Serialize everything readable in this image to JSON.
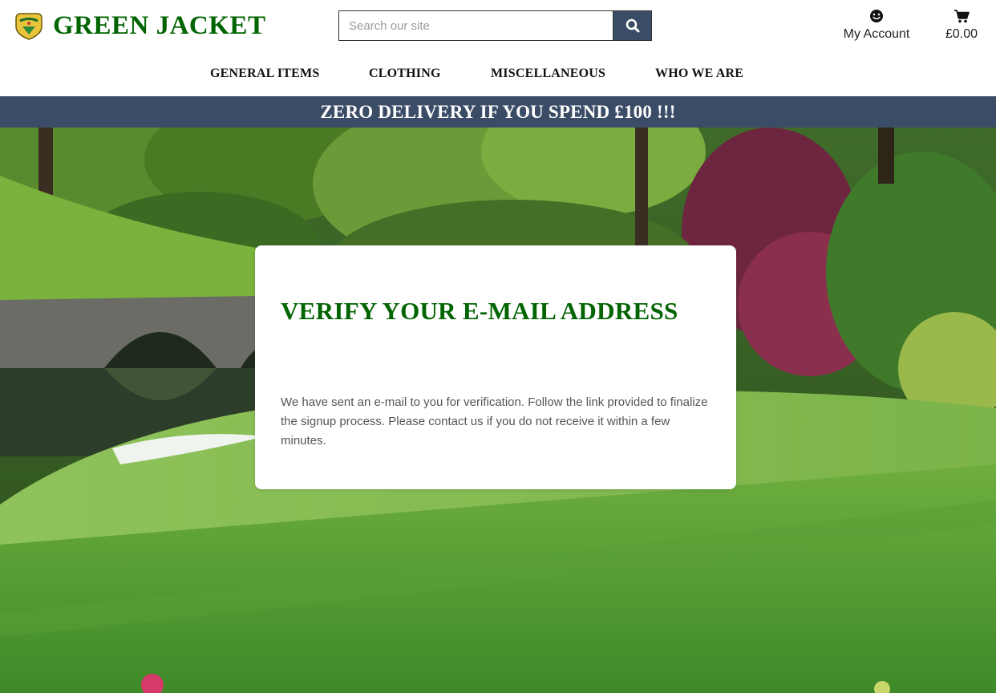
{
  "brand": {
    "name": "GREEN JACKET",
    "logo_icon": "masters-logo-icon",
    "color": "#006400"
  },
  "search": {
    "placeholder": "Search our site",
    "value": "",
    "button_icon": "search-icon"
  },
  "account": {
    "label": "My Account",
    "icon": "smiley-icon"
  },
  "cart": {
    "total": "£0.00",
    "icon": "shopping-cart-icon"
  },
  "nav": {
    "items": [
      {
        "label": "GENERAL ITEMS"
      },
      {
        "label": "CLOTHING"
      },
      {
        "label": "MISCELLANEOUS"
      },
      {
        "label": "WHO WE ARE"
      }
    ]
  },
  "banner": {
    "text": "ZERO DELIVERY IF YOU SPEND £100 !!!",
    "color": "#3b4d66"
  },
  "card": {
    "title": "VERIFY YOUR E-MAIL ADDRESS",
    "body": "We have sent an e-mail to you for verification. Follow the link provided to finalize the signup process. Please contact us if you do not receive it within a few minutes."
  }
}
